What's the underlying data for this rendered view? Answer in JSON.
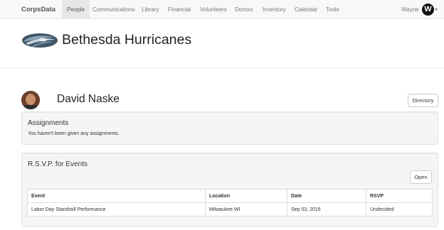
{
  "navbar": {
    "brand": "CorpsData",
    "items": [
      {
        "label": "People",
        "active": true
      },
      {
        "label": "Communications"
      },
      {
        "label": "Library"
      },
      {
        "label": "Financial"
      },
      {
        "label": "Volunteers"
      },
      {
        "label": "Donors"
      },
      {
        "label": "Inventory"
      },
      {
        "label": "Calendar"
      },
      {
        "label": "Tools"
      }
    ],
    "user_name": "Wayne",
    "user_initial": "W"
  },
  "team": {
    "name": "Bethesda Hurricanes"
  },
  "profile": {
    "name": "David Naske",
    "directory_label": "Directory"
  },
  "assignments": {
    "title": "Assignments",
    "message": "You haven't been given any assignments."
  },
  "rsvp": {
    "title": "R.S.V.P. for Events",
    "open_label": "Open",
    "columns": [
      "Event",
      "Location",
      "Date",
      "RSVP"
    ],
    "rows": [
      {
        "event": "Labor Day Standstill Performance",
        "location": "Milwaukee WI",
        "date": "Sep 03, 2016",
        "rsvp": "Undecided"
      }
    ]
  },
  "colors": {
    "navbar_bg": "#f8f8f8",
    "nav_active_bg": "#e7e7e7",
    "well_bg": "#f5f5f5",
    "text": "#333333"
  }
}
